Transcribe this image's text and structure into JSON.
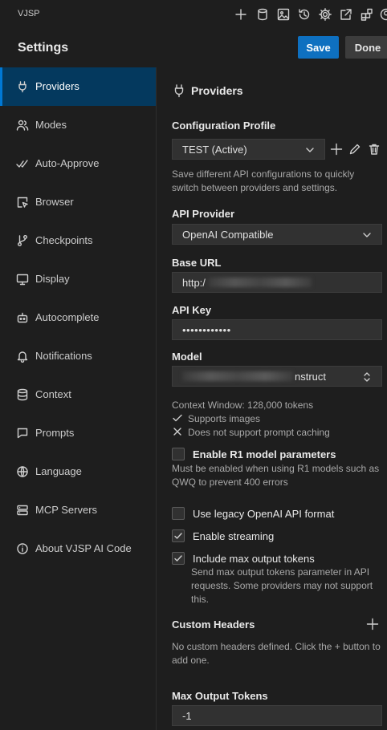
{
  "app": {
    "title": "VJSP"
  },
  "header": {
    "title": "Settings",
    "save_label": "Save",
    "done_label": "Done"
  },
  "top_icons": [
    "plus-icon",
    "database-icon",
    "image-icon",
    "history-icon",
    "gear-icon",
    "external-link-icon",
    "extensions-icon",
    "account-icon"
  ],
  "sidebar": {
    "items": [
      {
        "label": "Providers",
        "icon": "plug-icon",
        "active": true
      },
      {
        "label": "Modes",
        "icon": "users-icon"
      },
      {
        "label": "Auto-Approve",
        "icon": "check-double-icon"
      },
      {
        "label": "Browser",
        "icon": "browser-pointer-icon"
      },
      {
        "label": "Checkpoints",
        "icon": "git-branch-icon"
      },
      {
        "label": "Display",
        "icon": "monitor-icon"
      },
      {
        "label": "Autocomplete",
        "icon": "robot-icon"
      },
      {
        "label": "Notifications",
        "icon": "bell-icon"
      },
      {
        "label": "Context",
        "icon": "database-icon"
      },
      {
        "label": "Prompts",
        "icon": "message-icon"
      },
      {
        "label": "Language",
        "icon": "globe-icon"
      },
      {
        "label": "MCP Servers",
        "icon": "server-icon"
      },
      {
        "label": "About VJSP AI Code",
        "icon": "info-icon"
      }
    ]
  },
  "providers": {
    "section_title": "Providers",
    "config_profile": {
      "label": "Configuration Profile",
      "value": "TEST (Active)",
      "description": "Save different API configurations to quickly switch between providers and settings."
    },
    "api_provider": {
      "label": "API Provider",
      "value": "OpenAI Compatible"
    },
    "base_url": {
      "label": "Base URL",
      "value": "http:/"
    },
    "api_key": {
      "label": "API Key",
      "value": "••••••••••••"
    },
    "model": {
      "label": "Model",
      "value": "nstruct"
    },
    "model_info": {
      "context_window": "Context Window: 128,000 tokens",
      "supports_images": "Supports images",
      "no_prompt_caching": "Does not support prompt caching"
    },
    "r1_params": {
      "label": "Enable R1 model parameters",
      "checked": false,
      "description": "Must be enabled when using R1 models such as QWQ to prevent 400 errors"
    },
    "legacy_format": {
      "label": "Use legacy OpenAI API format",
      "checked": false
    },
    "streaming": {
      "label": "Enable streaming",
      "checked": true
    },
    "max_output": {
      "label": "Include max output tokens",
      "checked": true,
      "description": "Send max output tokens parameter in API requests. Some providers may not support this."
    },
    "custom_headers": {
      "label": "Custom Headers",
      "empty_text": "No custom headers defined. Click the + button to add one."
    },
    "max_output_tokens": {
      "label": "Max Output Tokens",
      "value": "-1"
    }
  },
  "colors": {
    "accent": "#0e70c0",
    "active_bg": "#04395e",
    "background": "#1e1e1e",
    "input_bg": "#313131"
  }
}
